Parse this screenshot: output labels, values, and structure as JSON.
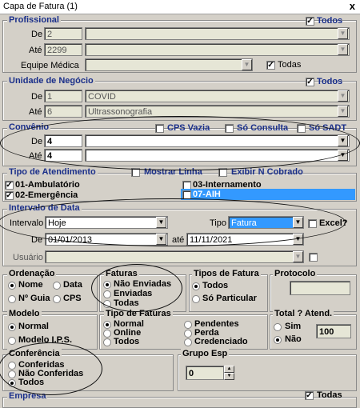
{
  "window": {
    "title": "Capa de Fatura (1)",
    "close": "x"
  },
  "profissional": {
    "legend": "Profissional",
    "todos": "Todos",
    "de_label": "De",
    "de_value": "2",
    "ate_label": "Até",
    "ate_value": "2299",
    "equipe_label": "Equipe Médica",
    "todas": "Todas"
  },
  "unidade": {
    "legend": "Unidade de Negócio",
    "todos": "Todos",
    "de_label": "De",
    "de_code": "1",
    "de_name": "COVID",
    "ate_label": "Até",
    "ate_code": "6",
    "ate_name": "Ultrassonografia"
  },
  "convenio": {
    "legend": "Convênio",
    "cps_vazia": "CPS Vazia",
    "so_consulta": "Só Consulta",
    "so_sadt": "Só SADT",
    "de_label": "De",
    "de_value": "4",
    "ate_label": "Até",
    "ate_value": "4"
  },
  "atendimento": {
    "legend": "Tipo de Atendimento",
    "mostrar_linha": "Mostrar Linha",
    "exibir": "Exibir N Cobrado",
    "items": [
      "01-Ambulatório",
      "03-Internamento",
      "02-Emergência",
      "07-AIH"
    ]
  },
  "intervalo": {
    "legend": "Intervalo de Data",
    "intervalo_label": "Intervalo",
    "intervalo_value": "Hoje",
    "tipo_label": "Tipo",
    "tipo_value": "Fatura",
    "excel": "Excel?",
    "de_label": "De",
    "de_value": "01/01/2013",
    "ate_label": "até",
    "ate_value": "11/11/2021",
    "usuario_label": "Usuário"
  },
  "ordenacao": {
    "legend": "Ordenação",
    "nome": "Nome",
    "data": "Data",
    "guia": "Nº Guia",
    "cps": "CPS"
  },
  "faturas": {
    "legend": "Faturas",
    "options": [
      "Não Enviadas",
      "Enviadas",
      "Todas"
    ]
  },
  "tipos_fatura": {
    "legend": "Tipos de Fatura",
    "todos": "Todos",
    "particular": "Só Particular"
  },
  "protocolo": {
    "legend": "Protocolo"
  },
  "modelo": {
    "legend": "Modelo",
    "normal": "Normal",
    "ips": "Modelo I.P.S."
  },
  "tipo_faturas": {
    "legend": "Tipo de Faturas",
    "options": [
      "Normal",
      "Online",
      "Todos",
      "Pendentes",
      "Perda",
      "Credenciado"
    ]
  },
  "total": {
    "legend": "Total ? Atend.",
    "sim": "Sim",
    "nao": "Não",
    "value": "100"
  },
  "conferencia": {
    "legend": "Conferência",
    "options": [
      "Conferidas",
      "Não Conferidas",
      "Todos"
    ]
  },
  "grupo": {
    "legend": "Grupo Esp",
    "value": "0"
  },
  "empresa": {
    "legend": "Empresa",
    "todas": "Todas"
  }
}
